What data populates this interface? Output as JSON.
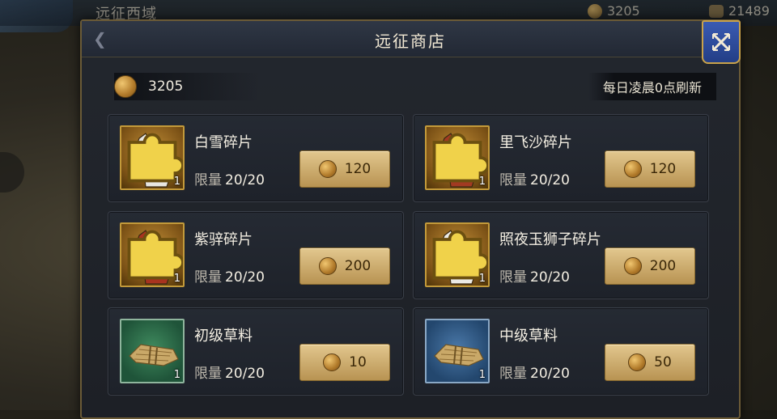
{
  "background": {
    "title": "远征西域",
    "coins": "3205",
    "other": "21489"
  },
  "shop": {
    "title": "远征商店",
    "coins": "3205",
    "refresh_text": "每日凌晨0点刷新",
    "limit_label": "限量",
    "items": [
      {
        "name": "白雪碎片",
        "limit": "20/20",
        "price": "120",
        "qty": "1",
        "type": "horse",
        "horse_color": "#e8e6e2",
        "frame": "gold"
      },
      {
        "name": "里飞沙碎片",
        "limit": "20/20",
        "price": "120",
        "qty": "1",
        "type": "horse",
        "horse_color": "#a23a22",
        "frame": "gold"
      },
      {
        "name": "紫骍碎片",
        "limit": "20/20",
        "price": "200",
        "qty": "1",
        "type": "horse",
        "horse_color": "#a8331f",
        "frame": "gold"
      },
      {
        "name": "照夜玉狮子碎片",
        "limit": "20/20",
        "price": "200",
        "qty": "1",
        "type": "horse",
        "horse_color": "#eceae5",
        "frame": "gold"
      },
      {
        "name": "初级草料",
        "limit": "20/20",
        "price": "10",
        "qty": "1",
        "type": "hay",
        "frame": "green"
      },
      {
        "name": "中级草料",
        "limit": "20/20",
        "price": "50",
        "qty": "1",
        "type": "hay",
        "frame": "blue"
      }
    ]
  }
}
